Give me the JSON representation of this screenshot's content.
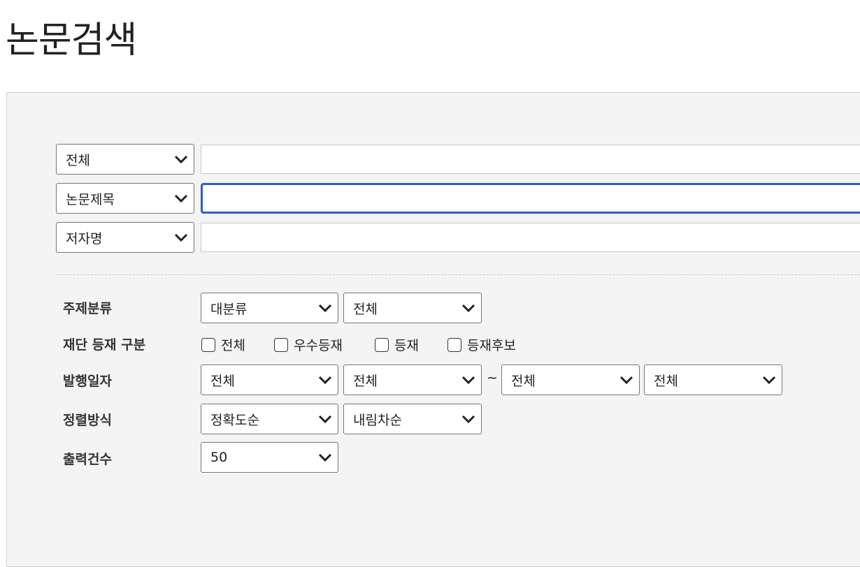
{
  "page_title": "논문검색",
  "search_rows": [
    {
      "field": "전체",
      "value": ""
    },
    {
      "field": "논문제목",
      "value": ""
    },
    {
      "field": "저자명",
      "value": ""
    }
  ],
  "filters": {
    "subject": {
      "label": "주제분류",
      "major": "대분류",
      "minor": "전체"
    },
    "registration": {
      "label": "재단 등재 구분",
      "options": [
        "전체",
        "우수등재",
        "등재",
        "등재후보"
      ]
    },
    "pub_date": {
      "label": "발행일자",
      "from_year": "전체",
      "from_month": "전체",
      "separator": "~",
      "to_year": "전체",
      "to_month": "전체"
    },
    "sort": {
      "label": "정렬방식",
      "by": "정확도순",
      "order": "내림차순"
    },
    "output_count": {
      "label": "출력건수",
      "value": "50"
    }
  },
  "colors": {
    "panel_bg": "#f4f4f4",
    "focus_border": "#2e5fc4"
  },
  "icons": {
    "dropdown": "chevron-down-icon"
  }
}
